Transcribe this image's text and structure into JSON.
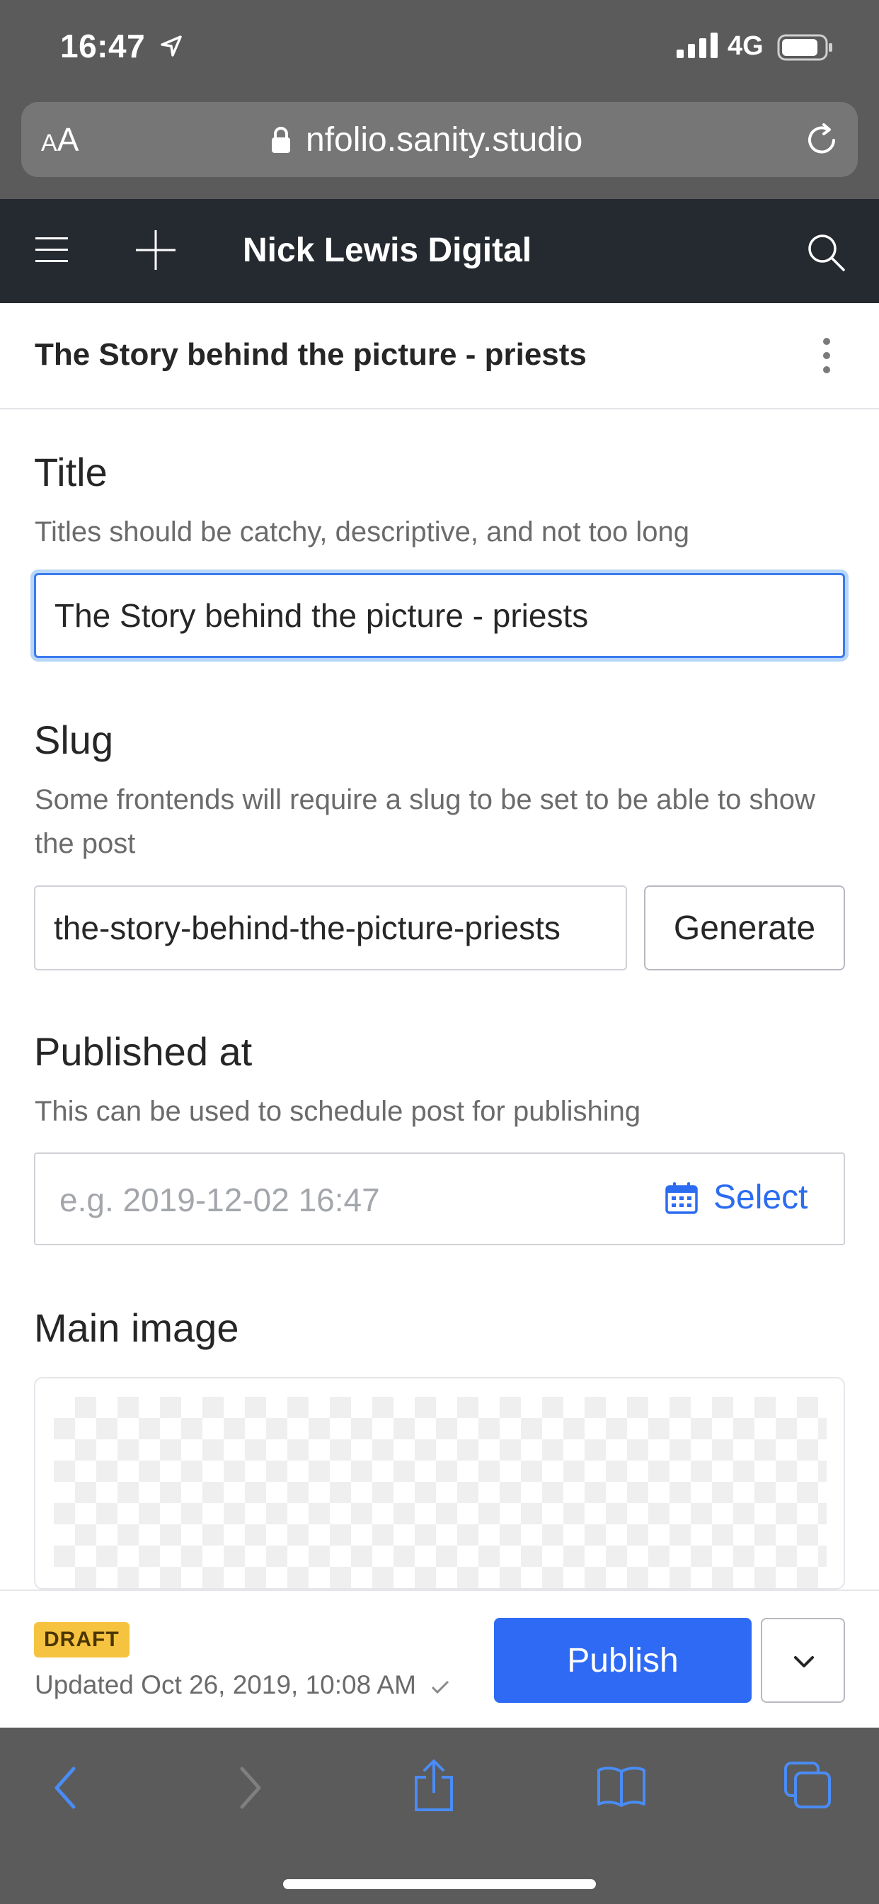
{
  "status_bar": {
    "time": "16:47",
    "network": "4G"
  },
  "url_bar": {
    "text_size_label_small": "A",
    "text_size_label_large": "A",
    "url": "nfolio.sanity.studio"
  },
  "app_nav": {
    "title": "Nick Lewis Digital"
  },
  "document": {
    "title": "The Story behind the picture - priests"
  },
  "form": {
    "title_field": {
      "label": "Title",
      "help": "Titles should be catchy, descriptive, and not too long",
      "value": "The Story behind the picture - priests"
    },
    "slug_field": {
      "label": "Slug",
      "help": "Some frontends will require a slug to be set to be able to show the post",
      "value": "the-story-behind-the-picture-priests",
      "generate_label": "Generate"
    },
    "published_at_field": {
      "label": "Published at",
      "help": "This can be used to schedule post for publishing",
      "placeholder": "e.g. 2019-12-02 16:47",
      "select_label": "Select"
    },
    "main_image_field": {
      "label": "Main image"
    }
  },
  "action_bar": {
    "status_badge": "DRAFT",
    "updated_text": "Updated Oct 26, 2019, 10:08 AM",
    "publish_label": "Publish"
  },
  "colors": {
    "accent": "#2e6af4",
    "navbar": "#252a31",
    "draft_badge": "#f6c340",
    "safari_chrome": "#5b5b5b"
  }
}
